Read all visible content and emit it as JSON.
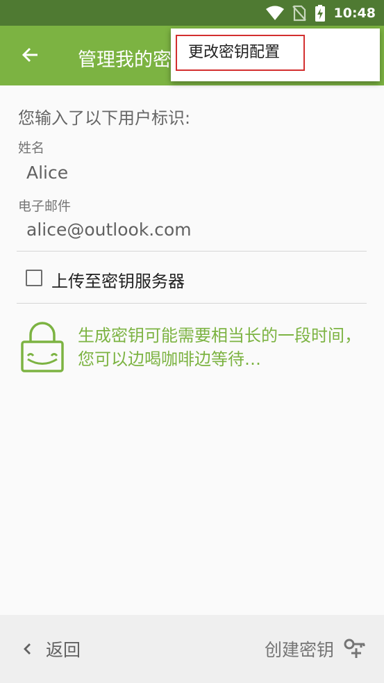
{
  "status_bar": {
    "time": "10:48",
    "icons": [
      "wifi-icon",
      "no-sim-icon",
      "battery-charging-icon"
    ]
  },
  "app_bar": {
    "title": "管理我的密钥"
  },
  "menu": {
    "items": [
      {
        "label": "更改密钥配置"
      }
    ]
  },
  "form": {
    "intro": "您输入了以下用户标识:",
    "name_label": "姓名",
    "name_value": "Alice",
    "email_label": "电子邮件",
    "email_value": "alice@outlook.com",
    "upload_label": "上传至密钥服务器",
    "upload_checked": false
  },
  "info": {
    "text": "生成密钥可能需要相当长的一段时间，您可以边喝咖啡边等待…"
  },
  "bottom_bar": {
    "back_label": "返回",
    "create_label": "创建密钥"
  },
  "colors": {
    "accent": "#7cb342",
    "status_bar": "#4f7a32",
    "menu_highlight": "#d32f2f"
  }
}
